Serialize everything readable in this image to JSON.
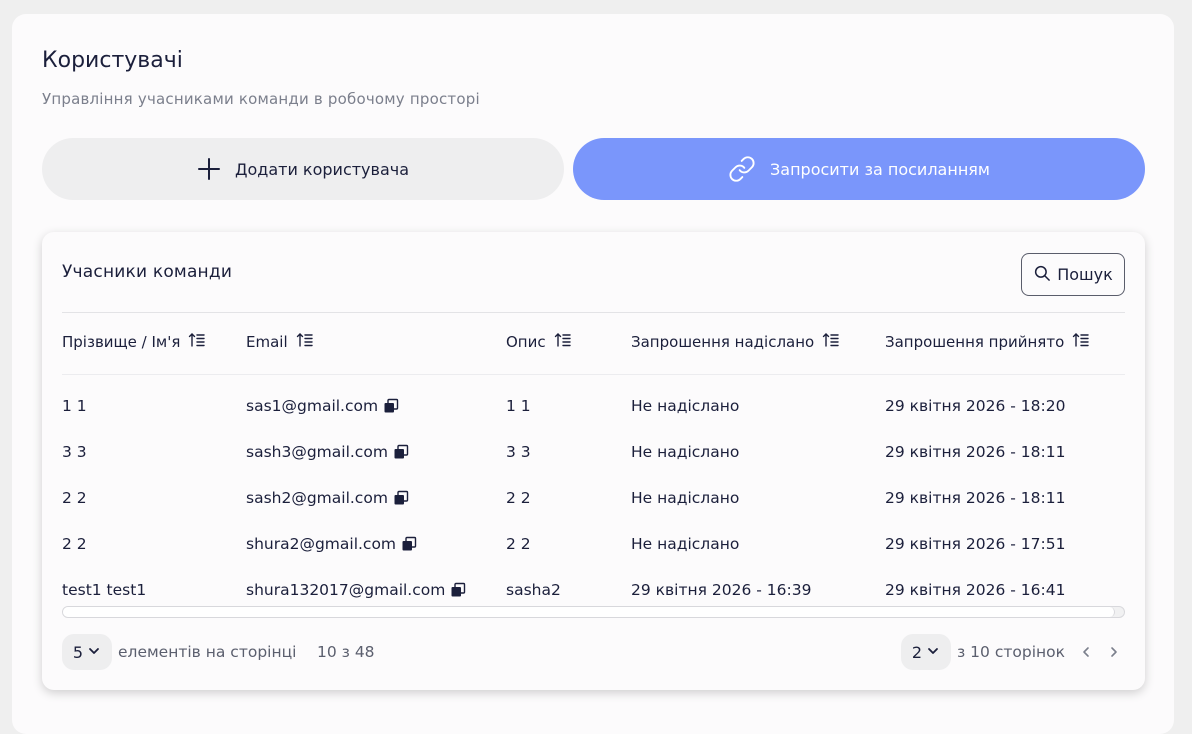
{
  "header": {
    "title": "Користувачі",
    "subtitle": "Управління учасниками команди в робочому просторі"
  },
  "actions": {
    "add_label": "Додати користувача",
    "invite_label": "Запросити за посиланням"
  },
  "card": {
    "title": "Учасники команди",
    "search_label": "Пошук"
  },
  "table": {
    "columns": [
      "Прізвище / Ім'я",
      "Email",
      "Опис",
      "Запрошення надіслано",
      "Запрошення прийнято"
    ],
    "rows": [
      {
        "name": "1 1",
        "email": "sas1@gmail.com",
        "description": "1 1",
        "sent": "Не надіслано",
        "accepted": "29 квітня 2026 - 18:20"
      },
      {
        "name": "3 3",
        "email": "sash3@gmail.com",
        "description": "3 3",
        "sent": "Не надіслано",
        "accepted": "29 квітня 2026 - 18:11"
      },
      {
        "name": "2 2",
        "email": "sash2@gmail.com",
        "description": "2 2",
        "sent": "Не надіслано",
        "accepted": "29 квітня 2026 - 18:11"
      },
      {
        "name": "2 2",
        "email": "shura2@gmail.com",
        "description": "2 2",
        "sent": "Не надіслано",
        "accepted": "29 квітня 2026 - 17:51"
      },
      {
        "name": "test1 test1",
        "email": "shura132017@gmail.com",
        "description": "sasha2",
        "sent": "29 квітня 2026 - 16:39",
        "accepted": "29 квітня 2026 - 16:41"
      }
    ]
  },
  "pagination": {
    "page_size": "5",
    "page_size_label": "елементів на сторінці",
    "range": "10 з 48",
    "current_page": "2",
    "total_pages_label": "з 10 сторінок"
  },
  "icons": {
    "add": "plus-icon",
    "invite": "link-icon",
    "search": "search-icon",
    "sort": "sort-ascending-icon",
    "copy": "copy-icon",
    "dropdown": "chevron-down-icon",
    "prev": "chevron-left-icon",
    "next": "chevron-right-icon"
  },
  "colors": {
    "accent": "#7a96fb",
    "text": "#1b1f3b",
    "muted": "#7b7f8c",
    "background": "#efefef",
    "surface": "#fcfbfc"
  }
}
